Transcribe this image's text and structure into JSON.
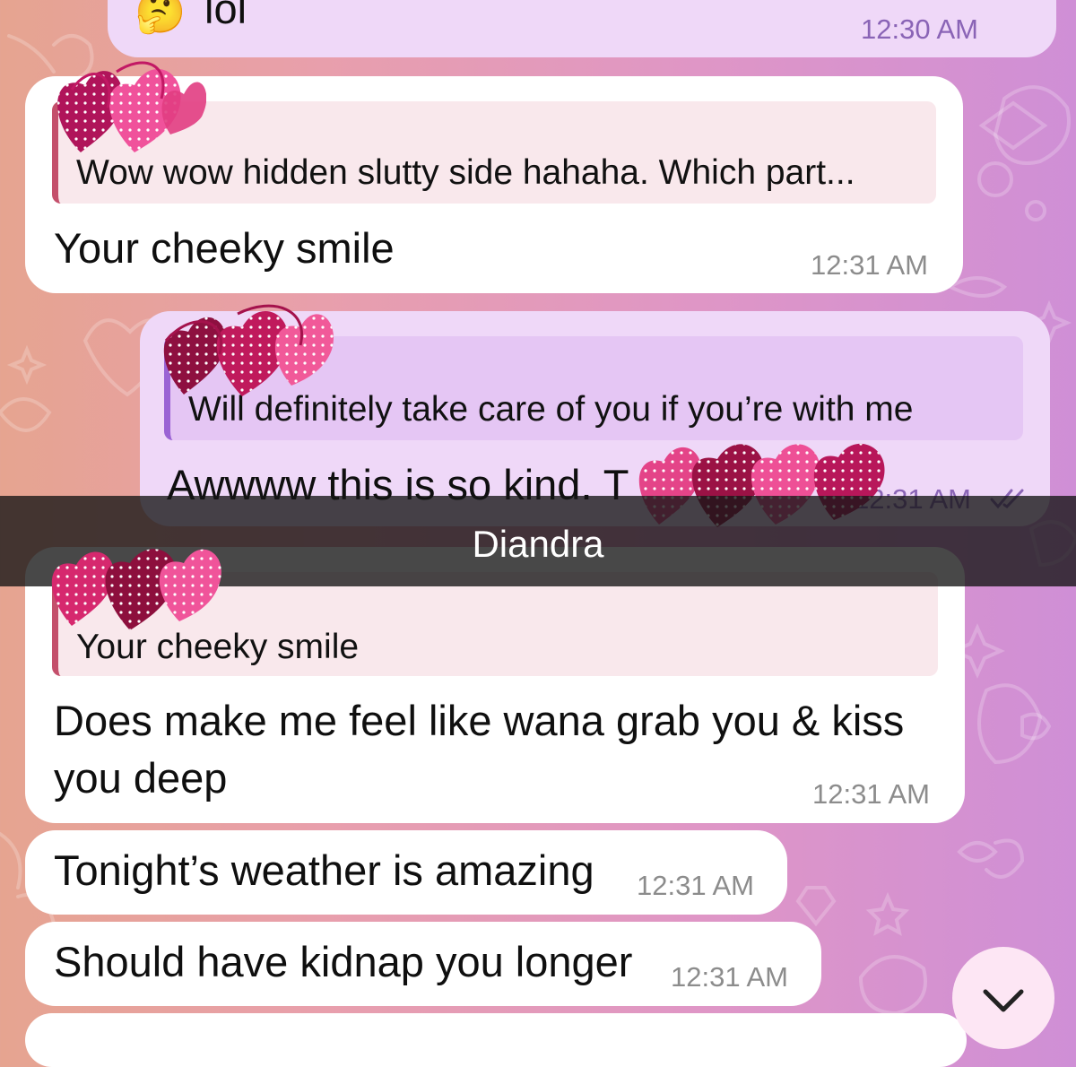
{
  "messages": [
    {
      "id": "m1",
      "text": "lol",
      "time": "12:30 AM",
      "emoji": "🤔"
    },
    {
      "id": "m2",
      "reply": "Wow wow hidden slutty side hahaha. Which part...",
      "text": "Your cheeky smile",
      "time": "12:31 AM"
    },
    {
      "id": "m3",
      "reply": "Will definitely take care of you if you’re with me",
      "text": "Awwww this is so kind. T",
      "time": "12:31 AM"
    },
    {
      "id": "m4",
      "reply": "Your cheeky smile",
      "text_line1": "Does make me feel like wana grab you & kiss",
      "text_line2": "you deep",
      "time": "12:31 AM"
    },
    {
      "id": "m5",
      "text": "Tonight’s weather is amazing",
      "time": "12:31 AM"
    },
    {
      "id": "m6",
      "text": "Should have kidnap you longer",
      "time": "12:31 AM"
    }
  ],
  "overlay": {
    "name": "Diandra"
  },
  "colors": {
    "outgoing_bubble": "#efd8f8",
    "incoming_bubble": "#ffffff",
    "reply_in_accent": "#c44f6b",
    "reply_out_accent": "#9a63d4",
    "time_out": "#8a64b6"
  },
  "icons": {
    "read_receipt": "double-check-icon",
    "scroll_down": "chevron-down-icon",
    "redaction": "heart-scribble-sticker"
  }
}
